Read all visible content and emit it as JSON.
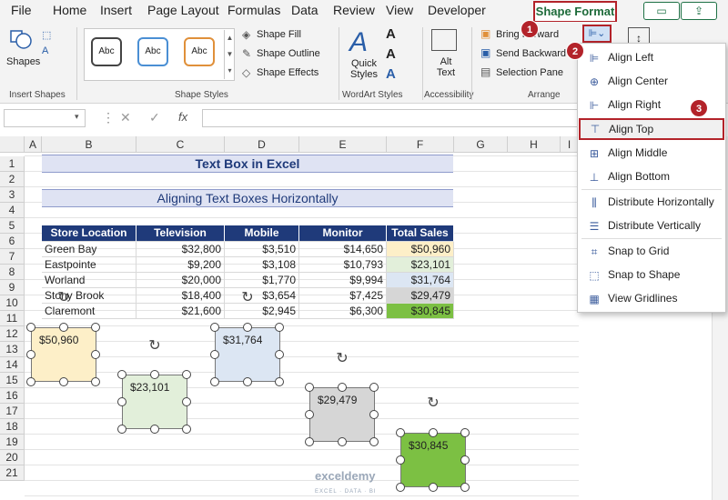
{
  "menu": {
    "tabs": [
      "File",
      "Home",
      "Insert",
      "Page Layout",
      "Formulas",
      "Data",
      "Review",
      "View",
      "Developer"
    ],
    "active_tab": "Shape Format"
  },
  "ribbon": {
    "insert_shapes": {
      "shapes_label": "Shapes",
      "group_label": "Insert Shapes"
    },
    "shape_styles": {
      "style_labels": [
        "Abc",
        "Abc",
        "Abc"
      ],
      "fill": "Shape Fill",
      "outline": "Shape Outline",
      "effects": "Shape Effects",
      "group_label": "Shape Styles"
    },
    "wordart": {
      "quick_styles": "Quick Styles",
      "group_label": "WordArt Styles"
    },
    "accessibility": {
      "alt_text": "Alt Text",
      "group_label": "Accessibility"
    },
    "arrange": {
      "bring_forward": "Bring Forward",
      "send_backward": "Send Backward",
      "selection_pane": "Selection Pane",
      "group_label": "Arrange"
    }
  },
  "formula_bar": {
    "fx": "fx",
    "name_box": "",
    "formula": ""
  },
  "columns": [
    "A",
    "B",
    "C",
    "D",
    "E",
    "F",
    "G",
    "H",
    "I"
  ],
  "rows": [
    "1",
    "2",
    "3",
    "4",
    "5",
    "6",
    "7",
    "8",
    "9",
    "10",
    "11",
    "12",
    "13",
    "14",
    "15",
    "16",
    "17",
    "18",
    "19",
    "20",
    "21"
  ],
  "sheet": {
    "title": "Text Box in Excel",
    "subtitle": "Aligning Text Boxes Horizontally",
    "headers": [
      "Store Location",
      "Television",
      "Mobile",
      "Monitor",
      "Total Sales"
    ],
    "data_rows": [
      [
        "Green Bay",
        "$32,800",
        "$3,510",
        "$14,650",
        "$50,960"
      ],
      [
        "Eastpointe",
        "$9,200",
        "$3,108",
        "$10,793",
        "$23,101"
      ],
      [
        "Worland",
        "$20,000",
        "$1,770",
        "$9,994",
        "$31,764"
      ],
      [
        "Stony Brook",
        "$18,400",
        "$3,654",
        "$7,425",
        "$29,479"
      ],
      [
        "Claremont",
        "$21,600",
        "$2,945",
        "$6,300",
        "$30,845"
      ]
    ]
  },
  "text_boxes": [
    "$50,960",
    "$23,101",
    "$31,764",
    "$29,479",
    "$30,845"
  ],
  "dropdown": {
    "items": [
      "Align Left",
      "Align Center",
      "Align Right",
      "Align Top",
      "Align Middle",
      "Align Bottom",
      "Distribute Horizontally",
      "Distribute Vertically",
      "Snap to Grid",
      "Snap to Shape",
      "View Gridlines"
    ],
    "selected": "Align Top"
  },
  "callouts": [
    "1",
    "2",
    "3"
  ],
  "watermark": {
    "name": "exceldemy",
    "tagline": "EXCEL · DATA · BI"
  },
  "colors": {
    "accent": "#1e6b3a",
    "callout": "#b3232a",
    "header_fill": "#1f3a7a",
    "box_fills": [
      "#fdefc8",
      "#e2efda",
      "#dce6f3",
      "#d6d6d6",
      "#7cc043"
    ]
  }
}
